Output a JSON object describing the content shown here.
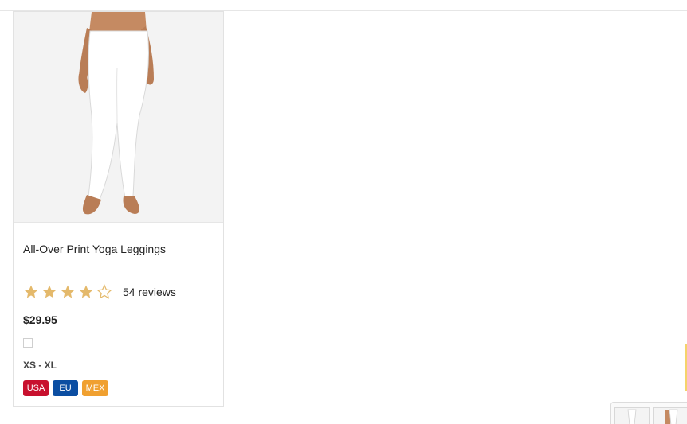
{
  "product": {
    "title": "All-Over Print Yoga Leggings",
    "rating": 4,
    "rating_max": 5,
    "reviews_label": "54 reviews",
    "price": "$29.95",
    "sizes": "XS - XL",
    "regions": [
      "USA",
      "EU",
      "MEX"
    ],
    "image_icon": "leggings-product-photo"
  },
  "colors": {
    "star_filled": "#e4b96b",
    "star_empty": "#e4b96b",
    "usa": "#c8102e",
    "eu": "#0b4ea2",
    "mex": "#f0a030"
  }
}
